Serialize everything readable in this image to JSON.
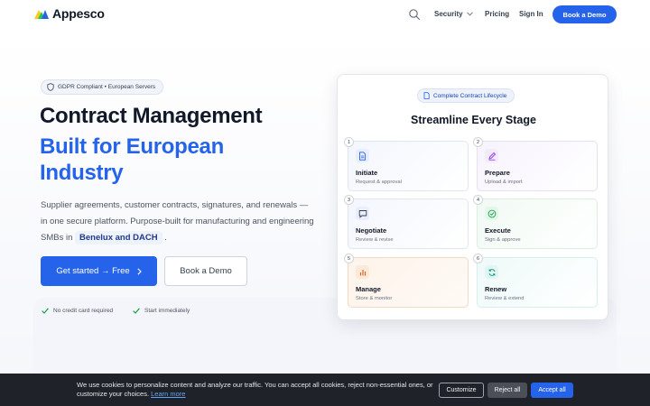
{
  "nav": {
    "brand": "Appesco",
    "security_label": "Security",
    "pricing_label": "Pricing",
    "signin_label": "Sign In",
    "demo_label": "Book a Demo"
  },
  "hero": {
    "badge": "GDPR Compliant • European Servers",
    "title_line1": "Contract Management",
    "title_line2": "Built for European Industry",
    "desc_before": "Supplier agreements, customer contracts, signatures, and renewals — in one secure platform. Purpose-built for manufacturing and engineering SMBs in ",
    "desc_highlight": "Benelux and DACH",
    "desc_after": " .",
    "cta_primary": "Get started → Free",
    "cta_secondary": "Book a Demo",
    "check_1": "No credit card required",
    "check_2": "Start immediately"
  },
  "card": {
    "badge": "Complete Contract Lifecycle",
    "title": "Streamline Every Stage",
    "steps": [
      {
        "num": "1",
        "name": "Initiate",
        "sub": "Request & approval",
        "icon": "document-icon"
      },
      {
        "num": "2",
        "name": "Prepare",
        "sub": "Upload & import",
        "icon": "pen-icon"
      },
      {
        "num": "3",
        "name": "Negotiate",
        "sub": "Review & revise",
        "icon": "chat-icon"
      },
      {
        "num": "4",
        "name": "Execute",
        "sub": "Sign & approve",
        "icon": "check-circle-icon"
      },
      {
        "num": "5",
        "name": "Manage",
        "sub": "Store & monitor",
        "icon": "bar-chart-icon"
      },
      {
        "num": "6",
        "name": "Renew",
        "sub": "Review & extend",
        "icon": "refresh-icon"
      }
    ]
  },
  "cookie": {
    "text": "We use cookies to personalize content and analyze our traffic. You can accept all cookies, reject non-essential ones, or customize your choices. ",
    "link": "Learn more",
    "customize": "Customize",
    "reject": "Reject all",
    "accept": "Accept all"
  },
  "colors": {
    "primary": "#2563eb",
    "cookie_bg": "#1f2228",
    "check_green": "#16a34a"
  }
}
